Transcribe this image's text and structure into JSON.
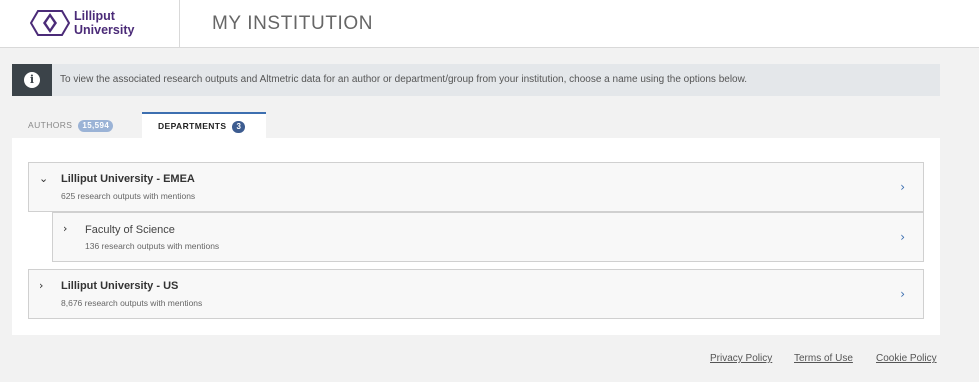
{
  "header": {
    "logo_line1": "Lilliput",
    "logo_line2": "University",
    "page_title": "MY INSTITUTION",
    "brand_color": "#4b2b78"
  },
  "info_banner": {
    "icon": "info-icon",
    "text": "To view the associated research outputs and Altmetric data for an author or department/group from your institution, choose a name using the options below."
  },
  "tabs": [
    {
      "label": "AUTHORS",
      "count": "15,594",
      "active": false
    },
    {
      "label": "DEPARTMENTS",
      "count": "3",
      "active": true
    }
  ],
  "departments": [
    {
      "name": "Lilliput University - EMEA",
      "subtitle": "625 research outputs with mentions",
      "expanded": true
    },
    {
      "name": "Faculty of Science",
      "subtitle": "136 research outputs with mentions",
      "expanded": false
    },
    {
      "name": "Lilliput University - US",
      "subtitle": "8,676 research outputs with mentions",
      "expanded": false
    }
  ],
  "footer": {
    "privacy": "Privacy Policy",
    "terms": "Terms of Use",
    "cookie": "Cookie Policy"
  },
  "accent_color": "#3d6fb0"
}
